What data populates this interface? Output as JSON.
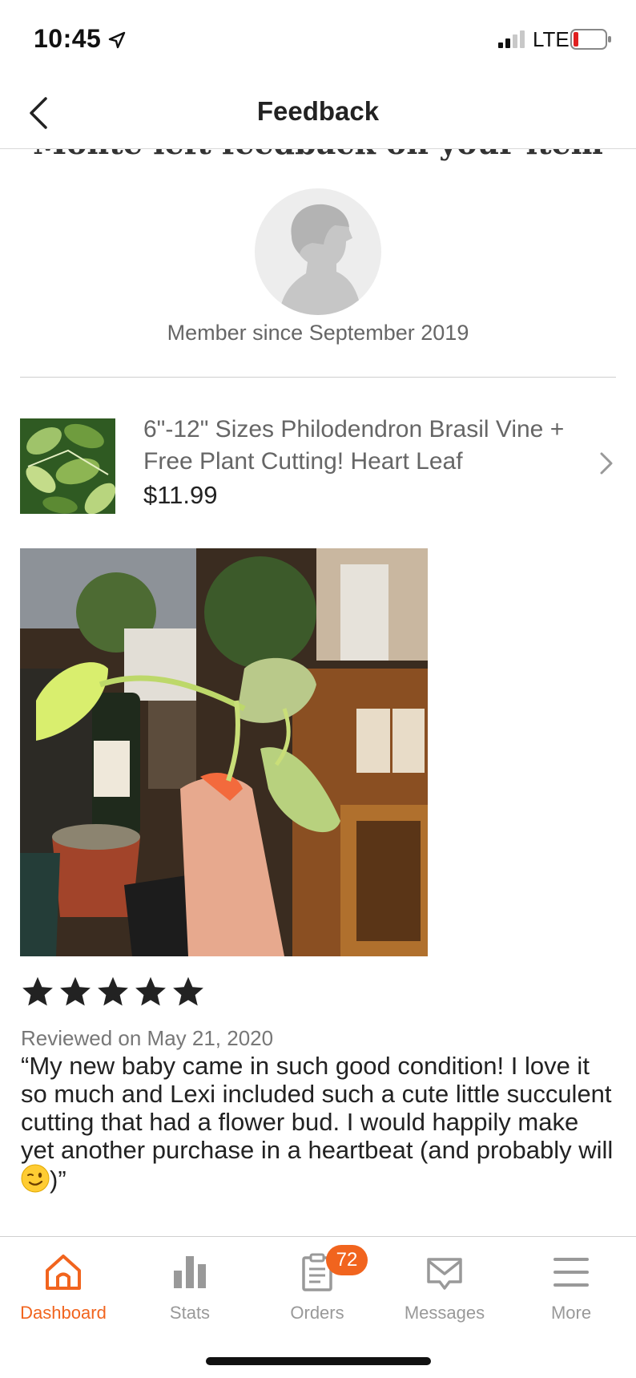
{
  "status_bar": {
    "time": "10:45",
    "network": "LTE"
  },
  "header": {
    "title": "Feedback"
  },
  "feedback": {
    "headline": "Monte left feedback on your item",
    "member_since": "Member since September 2019"
  },
  "item": {
    "title": "6\"-12\" Sizes Philodendron Brasil Vine + Free Plant Cutting! Heart Leaf",
    "price": "$11.99"
  },
  "review": {
    "rating": 5,
    "max_rating": 5,
    "date": "Reviewed on May 21, 2020",
    "text_before_emoji": "“My new baby came in such good condition! I love it so much and Lexi included such a cute little succulent cutting that had a flower bud. I would happily make yet another purchase in a heartbeat (and probably will",
    "emoji": "winking-face",
    "text_after_emoji": ")”"
  },
  "tabs": [
    {
      "label": "Dashboard",
      "icon": "home-icon",
      "active": true
    },
    {
      "label": "Stats",
      "icon": "bar-chart-icon",
      "active": false
    },
    {
      "label": "Orders",
      "icon": "clipboard-icon",
      "active": false,
      "badge": "72"
    },
    {
      "label": "Messages",
      "icon": "envelope-icon",
      "active": false
    },
    {
      "label": "More",
      "icon": "menu-icon",
      "active": false
    }
  ],
  "colors": {
    "accent": "#f1641e",
    "inactive": "#999999",
    "text": "#222222"
  }
}
